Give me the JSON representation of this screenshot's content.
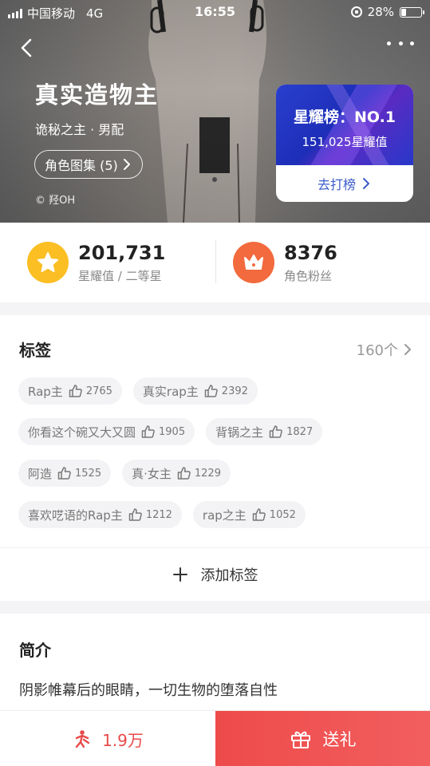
{
  "status_bar": {
    "carrier": "中国移动",
    "network": "4G",
    "time": "16:55",
    "battery": "28%",
    "battery_level": 0.28
  },
  "header": {
    "name": "真实造物主",
    "meta": "诡秘之主 · 男配",
    "gallery_label": "角色图集 (5)",
    "credit": "© 羟OH"
  },
  "rank_card": {
    "title": "星耀榜：NO.1",
    "value": "151,025星耀值",
    "action": "去打榜"
  },
  "stats": {
    "star_value": "201,731",
    "star_label": "星耀值 / 二等星",
    "fans_value": "8376",
    "fans_label": "角色粉丝"
  },
  "tags": {
    "title": "标签",
    "count": "160个",
    "rows": [
      [
        {
          "name": "Rap主",
          "likes": "2765"
        },
        {
          "name": "真实rap主",
          "likes": "2392"
        }
      ],
      [
        {
          "name": "你看这个碗又大又圆",
          "likes": "1905"
        },
        {
          "name": "背锅之主",
          "likes": "1827"
        }
      ],
      [
        {
          "name": "阿造",
          "likes": "1525"
        },
        {
          "name": "真·女主",
          "likes": "1229"
        }
      ],
      [
        {
          "name": "喜欢呓语的Rap主",
          "likes": "1212"
        },
        {
          "name": "rap之主",
          "likes": "1052"
        }
      ]
    ],
    "add_label": "添加标签"
  },
  "intro": {
    "title": "简介",
    "text": "阴影帷幕后的眼睛，一切生物的堕落自性"
  },
  "bottom_bar": {
    "fans_count": "1.9万",
    "gift_label": "送礼"
  },
  "colors": {
    "accent_red": "#ee4b4b",
    "rank_blue": "#2a3fcf",
    "star_yellow": "#fbbf24",
    "fans_orange": "#f26a3d"
  }
}
